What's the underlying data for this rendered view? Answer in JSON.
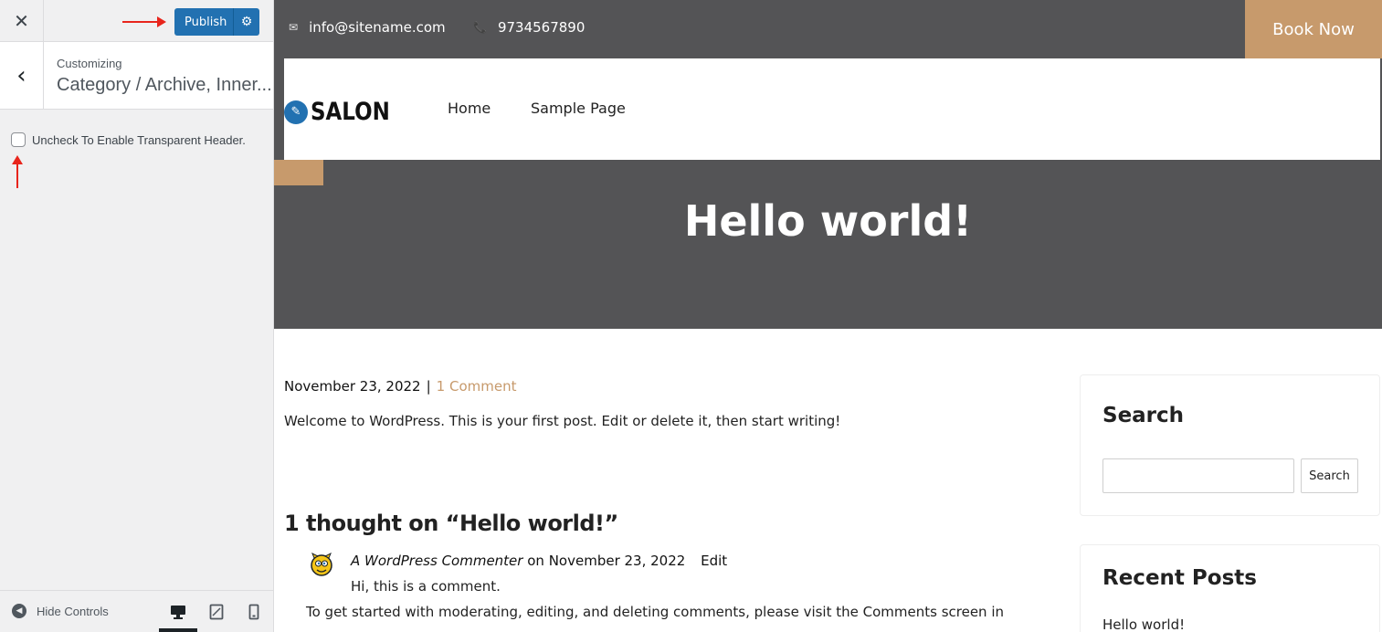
{
  "sidebar": {
    "close_icon": "close-icon",
    "publish_label": "Publish",
    "publish_settings_icon": "gear-icon",
    "section_small": "Customizing",
    "section_title": "Category / Archive, Inner...",
    "transparent_header_label": "Uncheck To Enable Transparent Header.",
    "transparent_header_checked": false,
    "hide_controls_label": "Hide Controls",
    "devices": [
      "desktop-icon",
      "tablet-icon",
      "mobile-icon"
    ],
    "active_device": "desktop"
  },
  "preview": {
    "topbar": {
      "email": "info@sitename.com",
      "phone": "9734567890",
      "book_now": "Book Now"
    },
    "logo_text": "SALON",
    "nav": {
      "home": "Home",
      "sample": "Sample Page"
    },
    "hero_title": "Hello world!",
    "post": {
      "date": "November 23, 2022",
      "separator": "|",
      "comments_link": "1 Comment",
      "body": "Welcome to WordPress. This is your first post. Edit or delete it, then start writing!"
    },
    "comments": {
      "heading": "1 thought on “Hello world!”",
      "author": "A WordPress Commenter",
      "on": "on",
      "date": "November 23, 2022",
      "edit": "Edit",
      "line1": "Hi, this is a comment.",
      "line2": "To get started with moderating, editing, and deleting comments, please visit the Comments screen in"
    },
    "sidebar_widgets": {
      "search_title": "Search",
      "search_button": "Search",
      "recent_title": "Recent Posts",
      "recent_item": "Hello world!"
    }
  },
  "colors": {
    "accent": "#c79a6c",
    "header_bg": "#545456",
    "wp_blue": "#2271b1",
    "annotation_red": "#e8251c"
  }
}
